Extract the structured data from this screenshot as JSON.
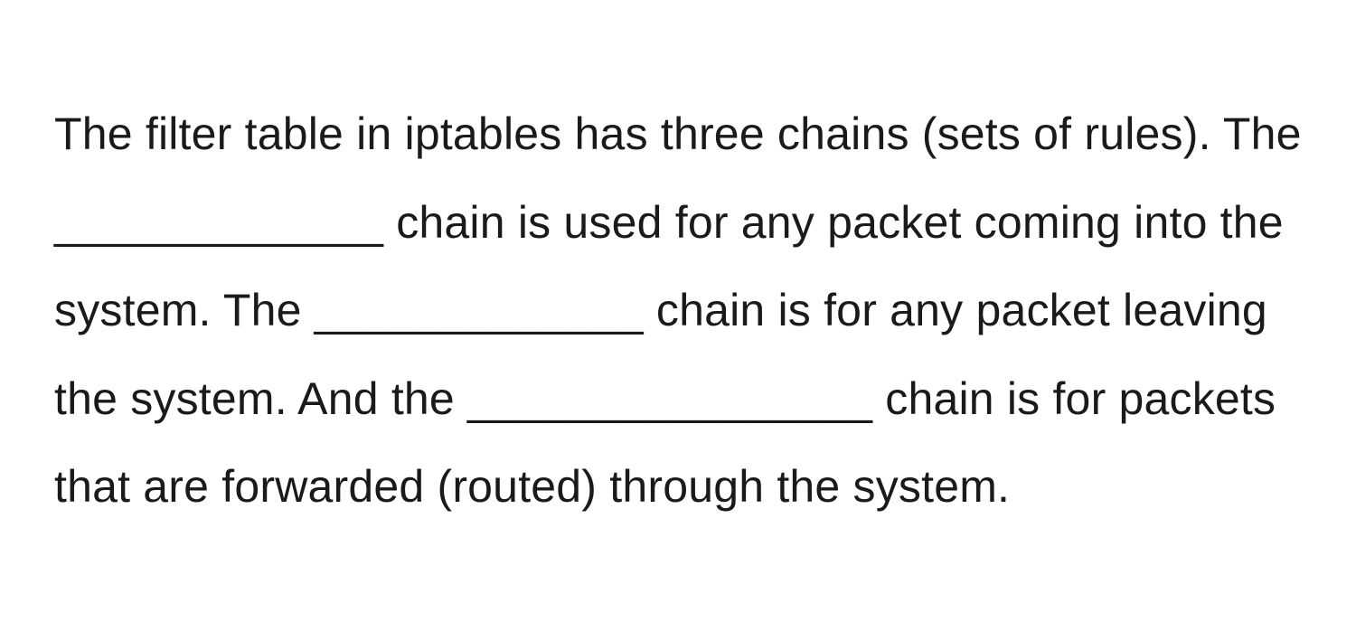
{
  "body_text": "The filter table in iptables has three chains (sets of rules). The _____________ chain is used for any packet coming into the system. The _____________ chain is for any packet leaving the system. And the ________________ chain is for packets that are forwarded (routed) through the system."
}
